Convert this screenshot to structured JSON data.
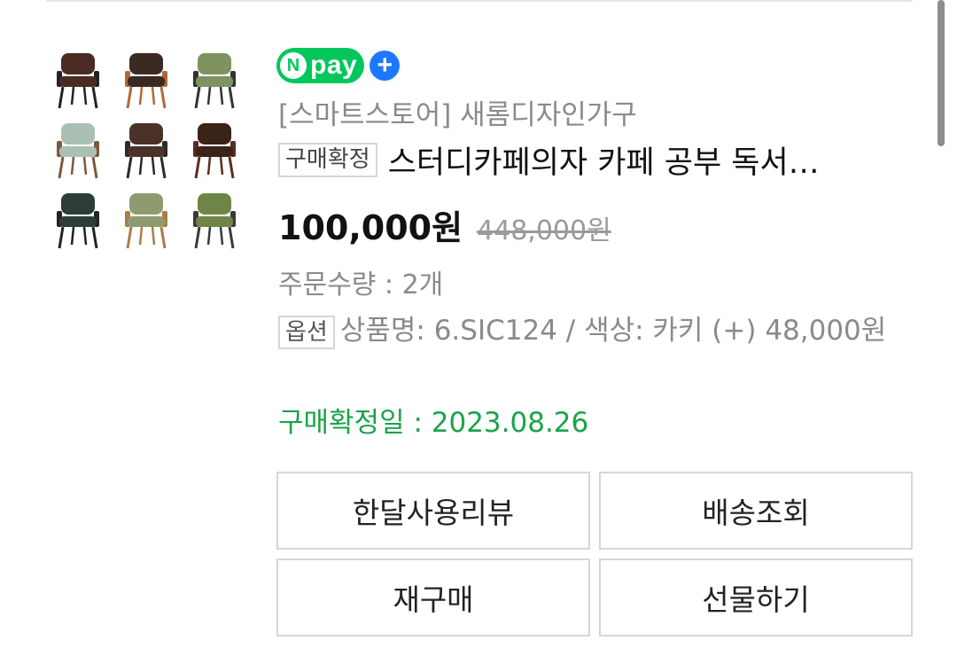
{
  "npay": {
    "logo_letter": "N",
    "logo_text": "pay",
    "plus": "+"
  },
  "product": {
    "store": "[스마트스토어] 새롬디자인가구",
    "status_badge": "구매확정",
    "title": "스터디카페의자 카페 공부 독서…",
    "price": "100,000원",
    "original_price": "448,000원",
    "quantity": "주문수량 : 2개",
    "option_badge": "옵션",
    "option_text": "상품명: 6.SIC124 / 색상: 카키 (+) 48,000원",
    "confirm_date": "구매확정일 : 2023.08.26"
  },
  "thumbnails": [
    {
      "name": "chair-brown-leather",
      "color": "#4a2b24",
      "leg": "#222"
    },
    {
      "name": "chair-brown-wood",
      "color": "#3b2a22",
      "leg": "#b06a3a"
    },
    {
      "name": "chair-khaki",
      "color": "#7f9360",
      "leg": "#333"
    },
    {
      "name": "chair-mint",
      "color": "#a9c0b3",
      "leg": "#7a5a3e"
    },
    {
      "name": "chair-dark-brown",
      "color": "#4a3228",
      "leg": "#2a2a2a"
    },
    {
      "name": "chair-dark-wood",
      "color": "#3a2418",
      "leg": "#5a2e1a"
    },
    {
      "name": "chair-dark-green",
      "color": "#2e3d3a",
      "leg": "#222"
    },
    {
      "name": "chair-light-khaki",
      "color": "#8f9a70",
      "leg": "#b07a45"
    },
    {
      "name": "chair-olive",
      "color": "#6f8545",
      "leg": "#3a3a3a"
    }
  ],
  "buttons": {
    "review": "한달사용리뷰",
    "tracking": "배송조회",
    "rebuy": "재구매",
    "gift": "선물하기"
  },
  "colors": {
    "npay_green": "#03c75a",
    "npay_plus_blue": "#1e78ff",
    "confirm_green": "#1aa34a"
  }
}
